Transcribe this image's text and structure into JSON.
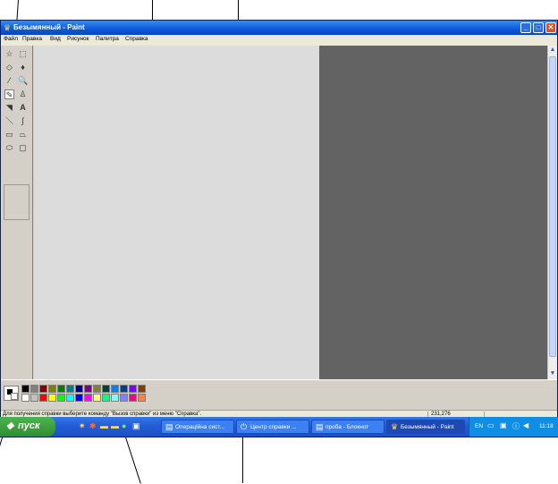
{
  "window": {
    "title": "Безымянный - Paint",
    "icon": "paint-app-icon",
    "buttons": {
      "minimize": "_",
      "maximize": "□",
      "close": "✕"
    }
  },
  "menu": [
    "Файл",
    "Правка",
    "Вид",
    "Рисунок",
    "Палитра",
    "Справка"
  ],
  "tools": [
    {
      "name": "free-select",
      "glyph": "☆"
    },
    {
      "name": "rect-select",
      "glyph": "⬚"
    },
    {
      "name": "eraser",
      "glyph": "◇"
    },
    {
      "name": "fill",
      "glyph": "♦"
    },
    {
      "name": "color-picker",
      "glyph": "⁄"
    },
    {
      "name": "magnifier",
      "glyph": "🔍"
    },
    {
      "name": "pencil",
      "glyph": "✎"
    },
    {
      "name": "brush",
      "glyph": "♙"
    },
    {
      "name": "airbrush",
      "glyph": "◥"
    },
    {
      "name": "text",
      "glyph": "A"
    },
    {
      "name": "line",
      "glyph": "＼"
    },
    {
      "name": "curve",
      "glyph": "∫"
    },
    {
      "name": "rectangle",
      "glyph": "▭"
    },
    {
      "name": "polygon",
      "glyph": "⏢"
    },
    {
      "name": "ellipse",
      "glyph": "⬭"
    },
    {
      "name": "rounded-rect",
      "glyph": "▢"
    }
  ],
  "palette": {
    "foreground": "#000000",
    "background": "#ffffff",
    "row1": [
      "#000000",
      "#808080",
      "#800000",
      "#808000",
      "#008000",
      "#008080",
      "#000080",
      "#800080",
      "#808040",
      "#004040",
      "#0080ff",
      "#004080",
      "#8000ff",
      "#804000"
    ],
    "row2": [
      "#ffffff",
      "#c0c0c0",
      "#ff0000",
      "#ffff00",
      "#00ff00",
      "#00ffff",
      "#0000ff",
      "#ff00ff",
      "#ffff80",
      "#00ff80",
      "#80ffff",
      "#8080ff",
      "#ff0080",
      "#ff8040"
    ]
  },
  "status": {
    "help": "Для получения справки выберите команду \"Вызов справки\" из меню \"Справка\".",
    "coords": "231,276"
  },
  "taskbar": {
    "start": "пуск",
    "tasks": [
      {
        "label": "Операційна сист...",
        "icon": "document-icon"
      },
      {
        "label": "Центр справки ...",
        "icon": "help-icon"
      },
      {
        "label": "проба - Блокнот",
        "icon": "notepad-icon"
      },
      {
        "label": "Безымянный - Paint",
        "icon": "paint-icon",
        "active": true
      }
    ],
    "lang": "EN",
    "clock": "11:18"
  }
}
